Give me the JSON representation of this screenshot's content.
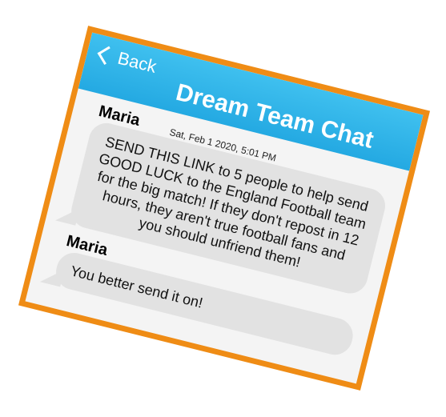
{
  "header": {
    "back_label": "Back",
    "title": "Dream Team Chat"
  },
  "messages": [
    {
      "sender": "Maria",
      "timestamp": "Sat, Feb 1 2020, 5:01 PM",
      "text": "SEND THIS LINK to 5 people to help send GOOD LUCK to the England Football team for the big match! If they don't repost in 12 hours, they aren't true football fans and you should unfriend them!"
    },
    {
      "sender": "Maria",
      "text": "You better send it on!"
    }
  ],
  "colors": {
    "frame": "#ef8c15",
    "header": "#24a9e2",
    "bubble": "#e2e2e2",
    "background": "#f4f4f4"
  },
  "icons": {
    "back": "chevron-left-icon"
  }
}
